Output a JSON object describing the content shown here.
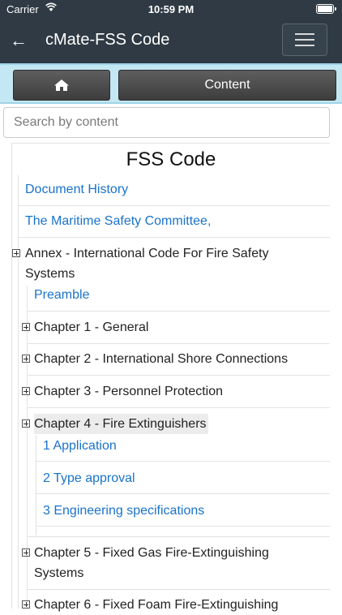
{
  "status": {
    "carrier": "Carrier",
    "time": "10:59 PM"
  },
  "nav": {
    "title": "cMate-FSS Code"
  },
  "toolbar": {
    "content_label": "Content"
  },
  "search": {
    "placeholder": "Search by content"
  },
  "document": {
    "title": "FSS Code",
    "items": {
      "history": "Document History",
      "committee": "The Maritime Safety Committee,",
      "annex": "Annex - International Code For Fire Safety Systems",
      "preamble": "Preamble",
      "ch1": "Chapter 1 - General",
      "ch2": "Chapter 2 - International Shore Connections",
      "ch3": "Chapter 3 - Personnel Protection",
      "ch4": "Chapter 4 - Fire Extinguishers",
      "ch4_1": "1 Application",
      "ch4_2": "2 Type approval",
      "ch4_3": "3 Engineering specifications",
      "ch5": "Chapter 5 - Fixed Gas Fire-Extinguishing Systems",
      "ch6": "Chapter 6 - Fixed Foam Fire-Extinguishing"
    }
  }
}
